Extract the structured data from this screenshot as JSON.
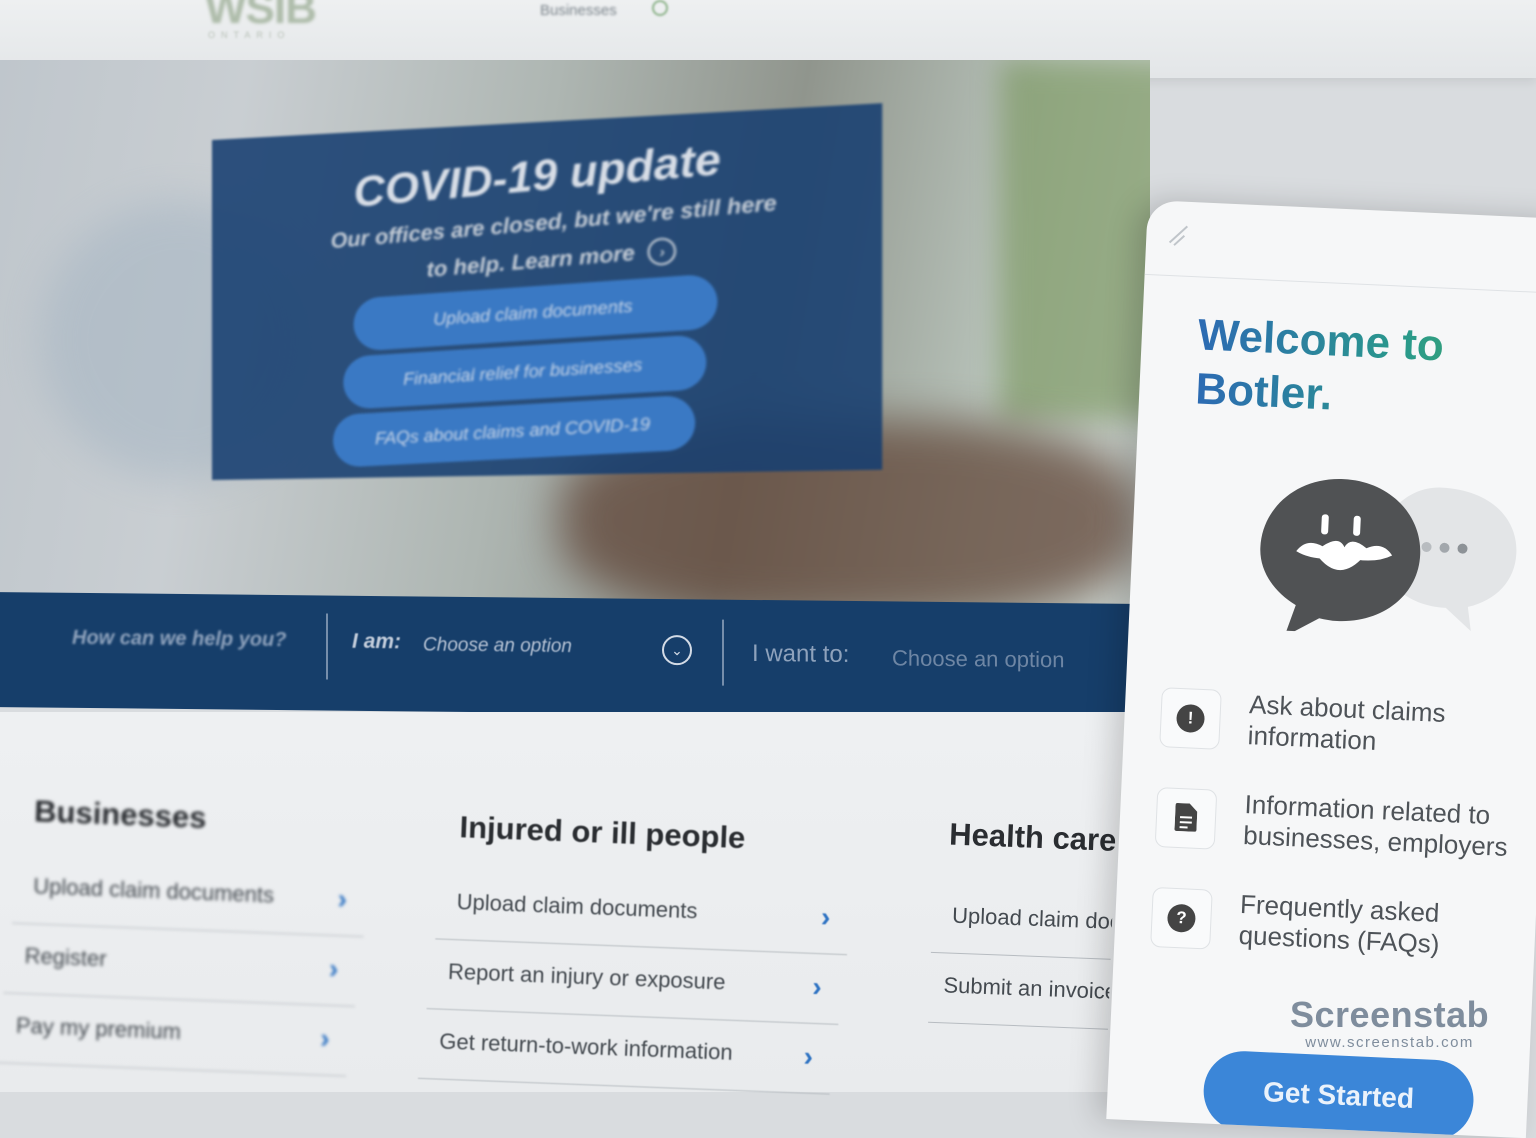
{
  "header": {
    "logo": "WSIB",
    "logo_sub": "ONTARIO",
    "nav_item": "Businesses"
  },
  "covid": {
    "title": "COVID-19 update",
    "subtitle": "Our offices are closed, but we're still here to help. Learn more",
    "buttons": [
      {
        "label": "Upload claim documents"
      },
      {
        "label": "Financial relief for businesses"
      },
      {
        "label": "FAQs about claims and COVID-19"
      }
    ]
  },
  "help": {
    "question": "How can we help you?",
    "i_am_label": "I am:",
    "i_am_value": "Choose an option",
    "i_want_label": "I want to:",
    "i_want_value": "Choose an option"
  },
  "columns": [
    {
      "title": "Businesses",
      "links": [
        {
          "label": "Upload claim documents"
        },
        {
          "label": "Register"
        },
        {
          "label": "Pay my premium"
        }
      ]
    },
    {
      "title": "Injured or ill people",
      "links": [
        {
          "label": "Upload claim documents"
        },
        {
          "label": "Report an injury or exposure"
        },
        {
          "label": "Get return-to-work information"
        }
      ]
    },
    {
      "title": "Health care",
      "links": [
        {
          "label": "Upload claim documents"
        },
        {
          "label": "Submit an invoice"
        }
      ]
    }
  ],
  "botler": {
    "welcome": "Welcome to Botler.",
    "features": [
      {
        "icon": "exclamation-icon",
        "label_line1": "Ask about claims",
        "label_line2": "information"
      },
      {
        "icon": "document-icon",
        "label_line1": "Information related to",
        "label_line2": "businesses, employers"
      },
      {
        "icon": "question-icon",
        "label_line1": "Frequently asked",
        "label_line2": "questions (FAQs)"
      }
    ],
    "cta": "Get Started",
    "accent_blue": "#2c6ab3",
    "accent_green": "#3aa46f"
  },
  "watermark": {
    "title": "Screenstab",
    "url": "www.screenstab.com"
  }
}
